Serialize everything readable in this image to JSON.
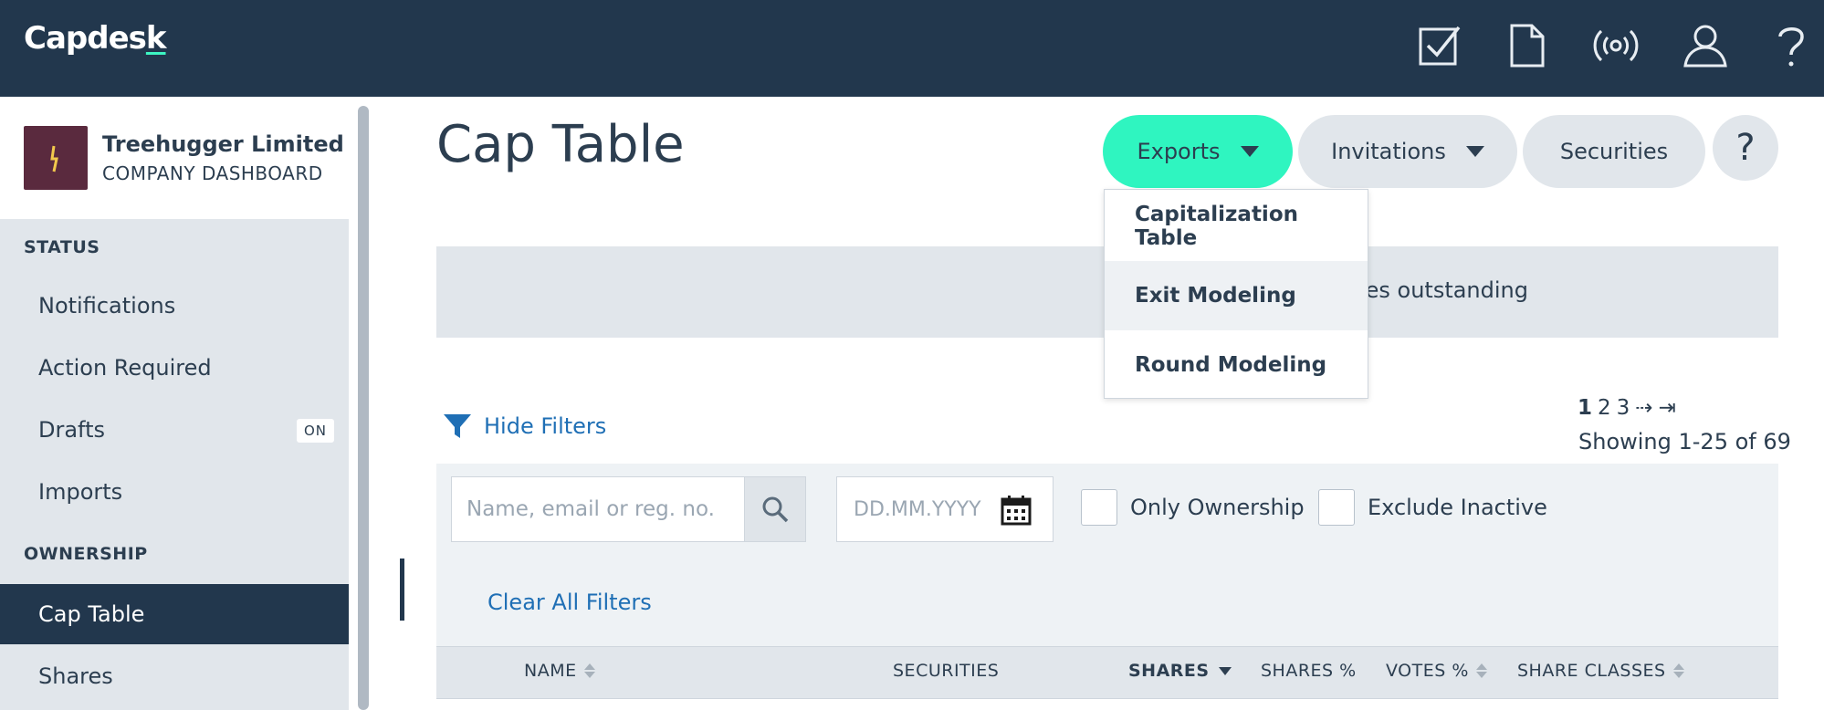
{
  "app": {
    "logo_prefix": "Capdes",
    "logo_k": "k"
  },
  "topnav": {
    "icons": [
      "tasks-checkbox-icon",
      "document-icon",
      "broadcast-icon",
      "user-icon",
      "help-icon"
    ]
  },
  "company": {
    "name": "Treehugger Limited",
    "subtitle": "COMPANY DASHBOARD"
  },
  "sidebar": {
    "status_heading": "STATUS",
    "status_items": [
      {
        "label": "Notifications"
      },
      {
        "label": "Action Required"
      },
      {
        "label": "Drafts",
        "badge": "ON"
      },
      {
        "label": "Imports"
      }
    ],
    "ownership_heading": "OWNERSHIP",
    "ownership_items": [
      {
        "label": "Cap Table",
        "active": true
      },
      {
        "label": "Shares"
      }
    ]
  },
  "main": {
    "title": "Cap Table",
    "buttons": {
      "exports": "Exports",
      "invitations": "Invitations",
      "securities": "Securities",
      "help": "?"
    },
    "exports_menu": [
      "Capitalization Table",
      "Exit Modeling",
      "Round Modeling"
    ],
    "banner_text": "Notes outstanding",
    "hide_filters": "Hide Filters",
    "pagination": {
      "pages": [
        "1",
        "2",
        "3"
      ],
      "next": "⇢",
      "last": "⇥",
      "current": "1",
      "showing": "Showing 1-25 of 69"
    },
    "filters": {
      "search_placeholder": "Name, email or reg. no.",
      "date_placeholder": "DD.MM.YYYY",
      "only_ownership": "Only Ownership",
      "exclude_inactive": "Exclude Inactive",
      "clear_all": "Clear All Filters"
    },
    "table": {
      "columns": [
        "NAME",
        "SECURITIES",
        "SHARES",
        "SHARES %",
        "VOTES %",
        "SHARE CLASSES"
      ],
      "sorted_column": "SHARES"
    }
  },
  "colors": {
    "topbar": "#22374d",
    "accent": "#2ff5c0",
    "link": "#1f6fb5",
    "sidebar_bg": "#e1e6eb"
  }
}
